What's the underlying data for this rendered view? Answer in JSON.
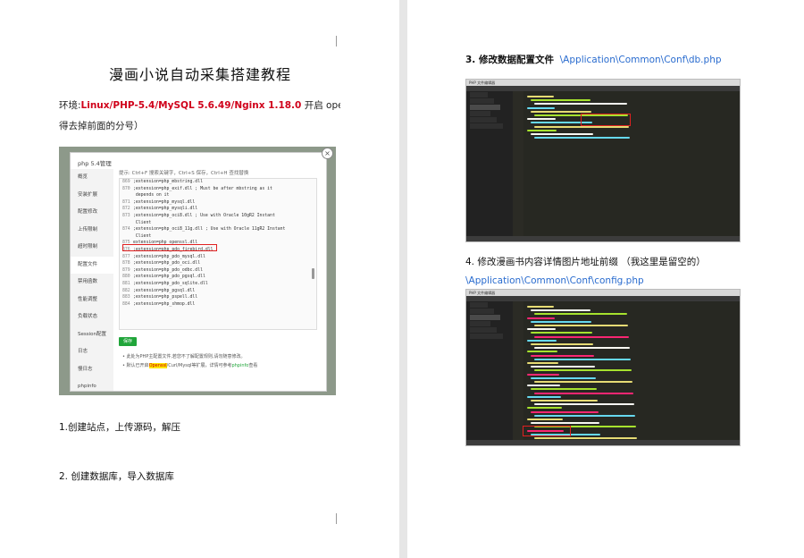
{
  "left_page": {
    "title": "漫画小说自动采集搭建教程",
    "env_prefix": "环境:",
    "env_stack": "Linux/PHP-5.4/MySQL 5.6.49/Nginx 1.18.0",
    "env_suffix": " 开启 openssl 扩展（记",
    "env_line2": "得去掉前面的分号）",
    "step1": "1.创建站点，上传源码，解压",
    "step2": "2. 创建数据库，导入数据库"
  },
  "php_dialog": {
    "title": "php 5.4管理",
    "close": "×",
    "tip": "提示: Ctrl+F 搜索关键字，Ctrl+S 保存，Ctrl+H 查找替换",
    "sidebar": [
      "概览",
      "安装扩展",
      "配置修改",
      "上传限制",
      "超时限制",
      "配置文件",
      "禁用函数",
      "性能调整",
      "负载状态",
      "Session配置",
      "日志",
      "慢日志",
      "phpinfo"
    ],
    "active_index": 5,
    "code_lines": [
      {
        "n": "869",
        "t": ";extension=php_mbstring.dll"
      },
      {
        "n": "870",
        "t": ";extension=php_exif.dll      ; Must be after mbstring as it"
      },
      {
        "n": "",
        "t": "      depends on it"
      },
      {
        "n": "871",
        "t": ";extension=php_mysql.dll"
      },
      {
        "n": "872",
        "t": ";extension=php_mysqli.dll"
      },
      {
        "n": "873",
        "t": ";extension=php_oci8.dll      ; Use with Oracle 10gR2 Instant"
      },
      {
        "n": "",
        "t": "      Client"
      },
      {
        "n": "874",
        "t": ";extension=php_oci8_11g.dll  ; Use with Oracle 11gR2 Instant"
      },
      {
        "n": "",
        "t": "      Client"
      },
      {
        "n": "875",
        "t": "extension=php_openssl.dll"
      },
      {
        "n": "876",
        "t": ";extension=php_pdo_firebird.dll"
      },
      {
        "n": "877",
        "t": ";extension=php_pdo_mysql.dll"
      },
      {
        "n": "878",
        "t": ";extension=php_pdo_oci.dll"
      },
      {
        "n": "879",
        "t": ";extension=php_pdo_odbc.dll"
      },
      {
        "n": "880",
        "t": ";extension=php_pdo_pgsql.dll"
      },
      {
        "n": "881",
        "t": ";extension=php_pdo_sqlite.dll"
      },
      {
        "n": "882",
        "t": ";extension=php_pgsql.dll"
      },
      {
        "n": "883",
        "t": ";extension=php_pspell.dll"
      },
      {
        "n": "884",
        "t": ";extension=php_shmop.dll"
      }
    ],
    "save": "保存",
    "note1": "此处为PHP主配置文件,若您不了解配置规则,请勿随意修改。",
    "note2_a": "默认已开启",
    "note2_hl": "Openssl",
    "note2_b": "/Curl/Mysql等扩展，详情可参考",
    "note2_g": "phpinfo",
    "note2_c": "查看"
  },
  "right_page": {
    "step3_label": "3. 修改数据配置文件",
    "step3_path": "\\Application\\Common\\Conf\\db.php",
    "step4_label": "4. 修改漫画书内容详情图片地址前缀  （我这里是留空的）",
    "step4_path": "\\Application\\Common\\Conf\\config.php"
  },
  "editor_db": {
    "menubar": "PHP 文件编辑器"
  },
  "editor_cfg": {
    "menubar": "PHP 文件编辑器"
  }
}
